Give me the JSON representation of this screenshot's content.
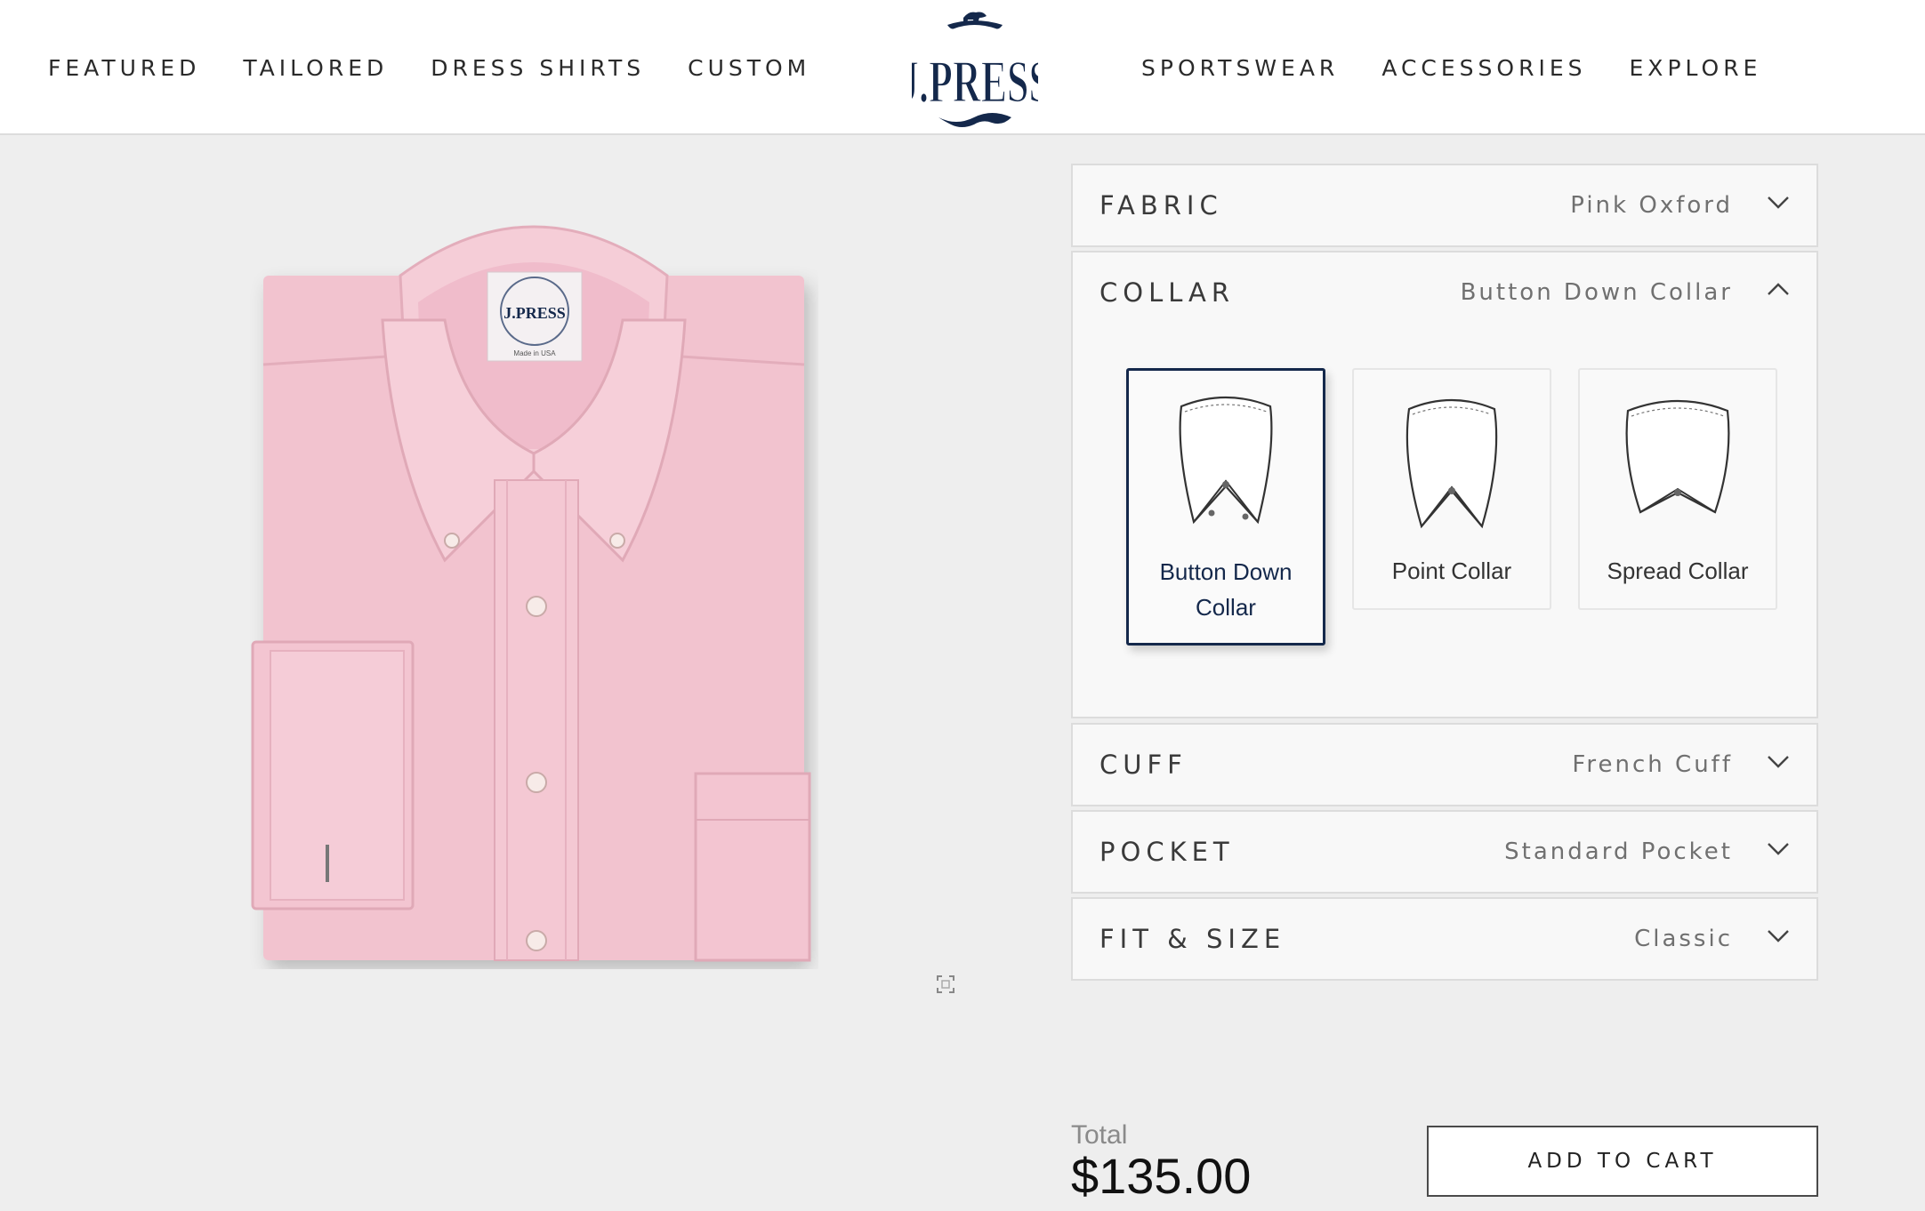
{
  "nav": {
    "left": [
      "FEATURED",
      "TAILORED",
      "DRESS SHIRTS",
      "CUSTOM"
    ],
    "right": [
      "SPORTSWEAR",
      "ACCESSORIES",
      "EXPLORE"
    ],
    "logo_text": "J.PRESS"
  },
  "product": {
    "label_text": "J.PRESS",
    "label_subtext": "Made in USA"
  },
  "options": {
    "fabric": {
      "title": "FABRIC",
      "value": "Pink Oxford",
      "expanded": false
    },
    "collar": {
      "title": "COLLAR",
      "value": "Button Down Collar",
      "expanded": true,
      "choices": [
        {
          "label": "Button Down Collar",
          "selected": true
        },
        {
          "label": "Point Collar",
          "selected": false
        },
        {
          "label": "Spread Collar",
          "selected": false
        }
      ]
    },
    "cuff": {
      "title": "CUFF",
      "value": "French Cuff",
      "expanded": false
    },
    "pocket": {
      "title": "POCKET",
      "value": "Standard Pocket",
      "expanded": false
    },
    "fit": {
      "title": "FIT & SIZE",
      "value": "Classic",
      "expanded": false
    }
  },
  "cart": {
    "total_label": "Total",
    "total_value": "$135.00",
    "button_label": "ADD TO CART"
  },
  "colors": {
    "navy": "#14284b",
    "shirt_pink": "#f2c3cf",
    "background": "#eeeeee"
  },
  "icons": {
    "collapsed": "chevron-down-icon",
    "expanded": "chevron-up-icon",
    "expand_view": "fullscreen-icon"
  }
}
